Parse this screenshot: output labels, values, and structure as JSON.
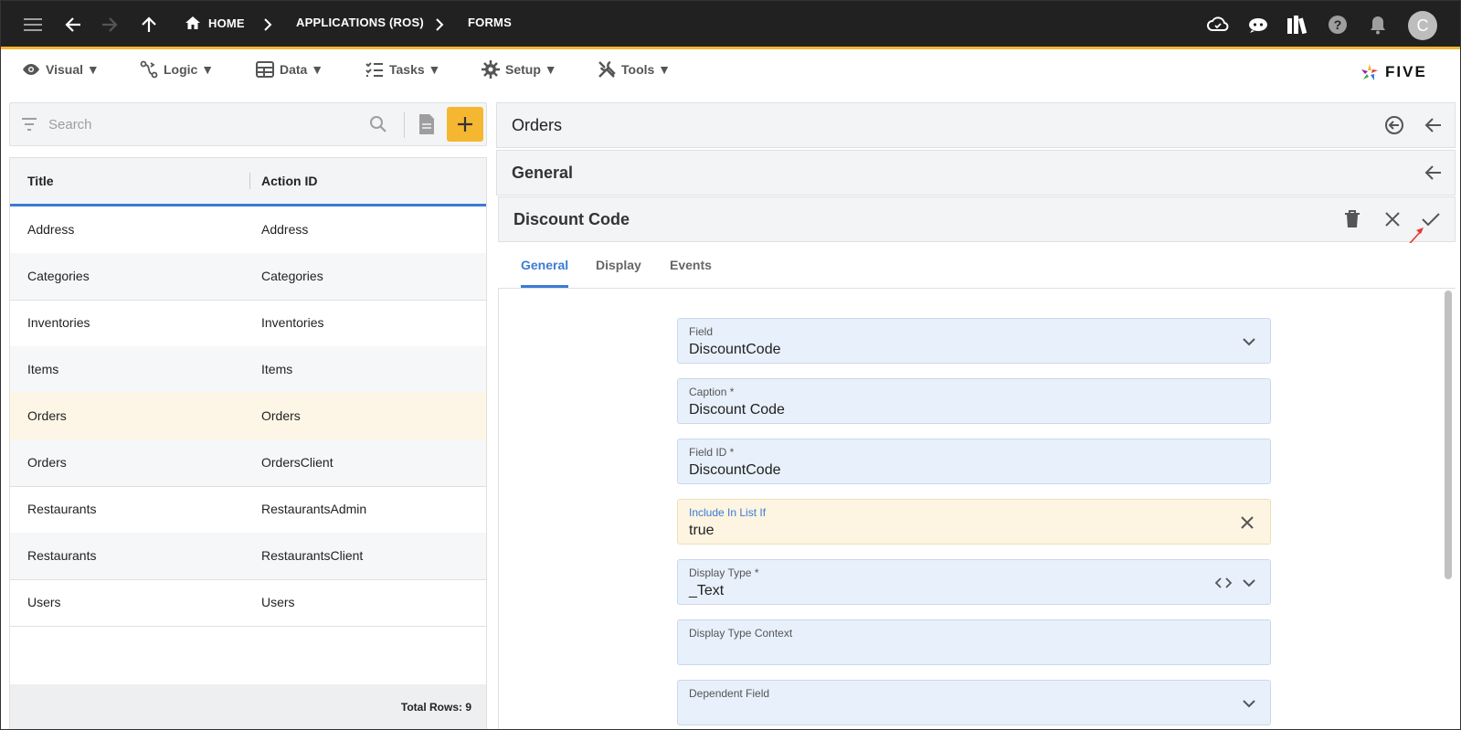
{
  "topbar": {
    "breadcrumbs": [
      {
        "label": "HOME"
      },
      {
        "label": "APPLICATIONS (ROS)"
      },
      {
        "label": "FORMS"
      }
    ],
    "avatar_initial": "C"
  },
  "menu": {
    "items": [
      {
        "label": "Visual ▼",
        "icon": "eye-icon"
      },
      {
        "label": "Logic ▼",
        "icon": "logic-icon"
      },
      {
        "label": "Data ▼",
        "icon": "table-icon"
      },
      {
        "label": "Tasks ▼",
        "icon": "tasks-icon"
      },
      {
        "label": "Setup ▼",
        "icon": "gear-icon"
      },
      {
        "label": "Tools ▼",
        "icon": "tools-icon"
      }
    ],
    "logo_text": "FIVE"
  },
  "search": {
    "placeholder": "Search"
  },
  "list": {
    "columns": [
      "Title",
      "Action ID"
    ],
    "rows": [
      {
        "title": "Address",
        "action_id": "Address"
      },
      {
        "title": "Categories",
        "action_id": "Categories"
      },
      {
        "title": "Inventories",
        "action_id": "Inventories"
      },
      {
        "title": "Items",
        "action_id": "Items"
      },
      {
        "title": "Orders",
        "action_id": "Orders"
      },
      {
        "title": "Orders",
        "action_id": "OrdersClient"
      },
      {
        "title": "Restaurants",
        "action_id": "RestaurantsAdmin"
      },
      {
        "title": "Restaurants",
        "action_id": "RestaurantsClient"
      },
      {
        "title": "Users",
        "action_id": "Users"
      }
    ],
    "total_rows": "Total Rows: 9"
  },
  "panels": {
    "orders_title": "Orders",
    "general_title": "General",
    "record_title": "Discount Code"
  },
  "tabs": [
    {
      "label": "General",
      "active": true
    },
    {
      "label": "Display",
      "active": false
    },
    {
      "label": "Events",
      "active": false
    }
  ],
  "form": {
    "fields": [
      {
        "label": "Field",
        "value": "DiscountCode"
      },
      {
        "label": "Caption *",
        "value": "Discount Code"
      },
      {
        "label": "Field ID *",
        "value": "DiscountCode"
      },
      {
        "label": "Include In List If",
        "value": "true"
      },
      {
        "label": "Display Type *",
        "value": "_Text"
      },
      {
        "label": "Display Type Context",
        "value": ""
      },
      {
        "label": "Dependent Field",
        "value": ""
      }
    ]
  },
  "colors": {
    "topbar_bg": "#212121",
    "accent": "#f5b731",
    "primary_blue": "#3a7bd5",
    "field_bg": "#e8f0fb",
    "selected_row_bg": "#fdf6e6"
  }
}
